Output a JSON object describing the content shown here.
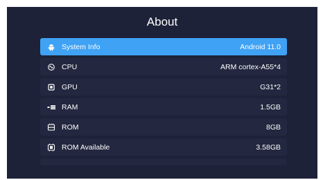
{
  "page": {
    "title": "About"
  },
  "items": [
    {
      "label": "System Info",
      "value": "Android 11.0",
      "icon": "android-icon"
    },
    {
      "label": "CPU",
      "value": "ARM cortex-A55*4",
      "icon": "cpu-icon"
    },
    {
      "label": "GPU",
      "value": "G31*2",
      "icon": "gpu-icon"
    },
    {
      "label": "RAM",
      "value": "1.5GB",
      "icon": "ram-icon"
    },
    {
      "label": "ROM",
      "value": "8GB",
      "icon": "rom-icon"
    },
    {
      "label": "ROM Available",
      "value": "3.58GB",
      "icon": "storage-icon"
    }
  ],
  "colors": {
    "background": "#1e2238",
    "row": "#23273f",
    "selected": "#3fa2f4",
    "text": "#ffffff"
  }
}
